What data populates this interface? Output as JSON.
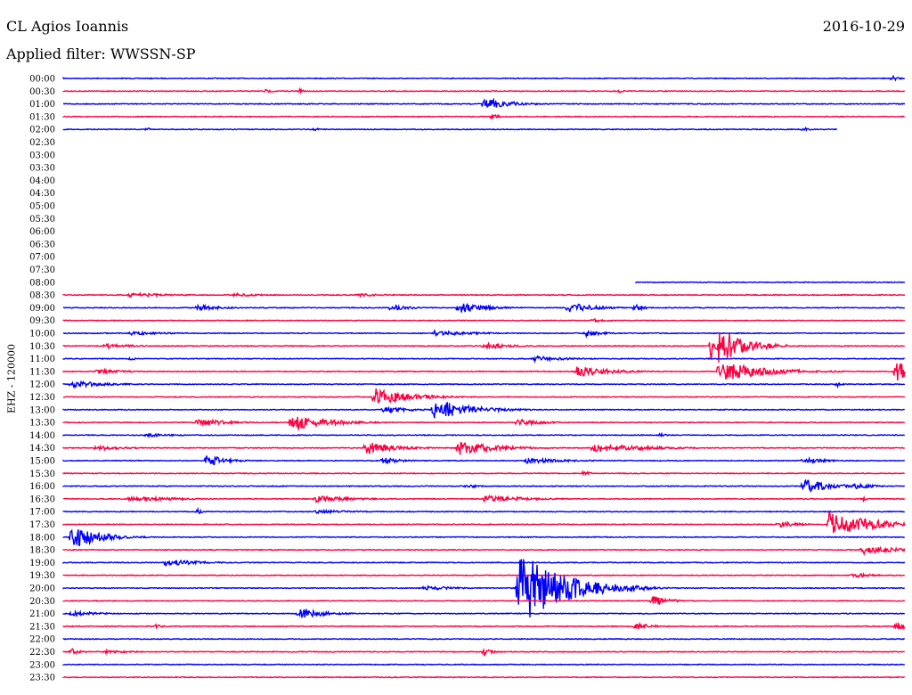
{
  "header": {
    "station": "CL Agios Ioannis",
    "date": "2016-10-29",
    "filter": "Applied filter: WWSSN-SP"
  },
  "axis": {
    "ylabel": "EHZ - 120000"
  },
  "colors": {
    "odd": "#0000ff",
    "even": "#ff0040"
  },
  "chart_data": {
    "type": "line",
    "title": "CL Agios Ioannis",
    "subtitle": "Applied filter: WWSSN-SP",
    "ylabel": "EHZ - 120000",
    "row_labels": [
      "00:00",
      "00:30",
      "01:00",
      "01:30",
      "02:00",
      "02:30",
      "03:00",
      "03:30",
      "04:00",
      "04:30",
      "05:00",
      "05:30",
      "06:00",
      "06:30",
      "07:00",
      "07:30",
      "08:00",
      "08:30",
      "09:00",
      "09:30",
      "10:00",
      "10:30",
      "11:00",
      "11:30",
      "12:00",
      "12:30",
      "13:00",
      "13:30",
      "14:00",
      "14:30",
      "15:00",
      "15:30",
      "16:00",
      "16:30",
      "17:00",
      "17:30",
      "18:00",
      "18:30",
      "19:00",
      "19:30",
      "20:00",
      "20:30",
      "21:00",
      "21:30",
      "22:00",
      "22:30",
      "23:00",
      "23:30"
    ],
    "row_span_minutes": 30,
    "traces": [
      {
        "row": "00:00",
        "start": 0,
        "end": 1.0,
        "events": [
          {
            "t": 0.985,
            "a": 3,
            "d": 0.008
          }
        ]
      },
      {
        "row": "00:30",
        "start": 0,
        "end": 1.0,
        "events": [
          {
            "t": 0.24,
            "a": 2,
            "d": 0.01
          },
          {
            "t": 0.28,
            "a": 3,
            "d": 0.005
          },
          {
            "t": 0.66,
            "a": 2,
            "d": 0.006
          }
        ]
      },
      {
        "row": "01:00",
        "start": 0,
        "end": 1.0,
        "events": [
          {
            "t": 0.5,
            "a": 7,
            "d": 0.03
          }
        ]
      },
      {
        "row": "01:30",
        "start": 0,
        "end": 1.0,
        "events": [
          {
            "t": 0.51,
            "a": 3,
            "d": 0.008
          }
        ]
      },
      {
        "row": "02:00",
        "start": 0,
        "end": 0.92,
        "events": [
          {
            "t": 0.1,
            "a": 2,
            "d": 0.005
          },
          {
            "t": 0.3,
            "a": 2,
            "d": 0.01
          },
          {
            "t": 0.88,
            "a": 3,
            "d": 0.006
          }
        ]
      },
      {
        "row": "08:00",
        "start": 0.68,
        "end": 1.0,
        "events": []
      },
      {
        "row": "08:30",
        "start": 0,
        "end": 1.0,
        "events": [
          {
            "t": 0.08,
            "a": 3,
            "d": 0.04
          },
          {
            "t": 0.2,
            "a": 2,
            "d": 0.04
          },
          {
            "t": 0.35,
            "a": 2,
            "d": 0.03
          }
        ]
      },
      {
        "row": "09:00",
        "start": 0,
        "end": 1.0,
        "events": [
          {
            "t": 0.16,
            "a": 3,
            "d": 0.03
          },
          {
            "t": 0.39,
            "a": 4,
            "d": 0.02
          },
          {
            "t": 0.47,
            "a": 6,
            "d": 0.03
          },
          {
            "t": 0.6,
            "a": 6,
            "d": 0.03
          },
          {
            "t": 0.68,
            "a": 4,
            "d": 0.01
          }
        ]
      },
      {
        "row": "09:30",
        "start": 0,
        "end": 1.0,
        "events": [
          {
            "t": 0.63,
            "a": 2,
            "d": 0.02
          }
        ]
      },
      {
        "row": "10:00",
        "start": 0,
        "end": 1.0,
        "events": [
          {
            "t": 0.08,
            "a": 2,
            "d": 0.05
          },
          {
            "t": 0.44,
            "a": 3,
            "d": 0.05
          },
          {
            "t": 0.62,
            "a": 4,
            "d": 0.02
          }
        ]
      },
      {
        "row": "10:30",
        "start": 0,
        "end": 1.0,
        "events": [
          {
            "t": 0.05,
            "a": 3,
            "d": 0.03
          },
          {
            "t": 0.5,
            "a": 4,
            "d": 0.03
          },
          {
            "t": 0.77,
            "a": 28,
            "d": 0.03
          }
        ]
      },
      {
        "row": "11:00",
        "start": 0,
        "end": 1.0,
        "events": [
          {
            "t": 0.08,
            "a": 3,
            "d": 0.005
          },
          {
            "t": 0.56,
            "a": 3,
            "d": 0.04
          }
        ]
      },
      {
        "row": "11:30",
        "start": 0,
        "end": 1.0,
        "events": [
          {
            "t": 0.04,
            "a": 3,
            "d": 0.03
          },
          {
            "t": 0.61,
            "a": 6,
            "d": 0.04
          },
          {
            "t": 0.78,
            "a": 12,
            "d": 0.05
          },
          {
            "t": 0.99,
            "a": 12,
            "d": 0.02
          }
        ]
      },
      {
        "row": "12:00",
        "start": 0,
        "end": 1.0,
        "events": [
          {
            "t": 0.01,
            "a": 4,
            "d": 0.04
          },
          {
            "t": 0.92,
            "a": 3,
            "d": 0.005
          }
        ]
      },
      {
        "row": "12:30",
        "start": 0,
        "end": 1.0,
        "events": [
          {
            "t": 0.37,
            "a": 10,
            "d": 0.04
          }
        ]
      },
      {
        "row": "13:00",
        "start": 0,
        "end": 1.0,
        "events": [
          {
            "t": 0.38,
            "a": 4,
            "d": 0.03
          },
          {
            "t": 0.44,
            "a": 12,
            "d": 0.04
          }
        ]
      },
      {
        "row": "13:30",
        "start": 0,
        "end": 1.0,
        "events": [
          {
            "t": 0.16,
            "a": 5,
            "d": 0.03
          },
          {
            "t": 0.27,
            "a": 10,
            "d": 0.04
          },
          {
            "t": 0.54,
            "a": 4,
            "d": 0.03
          }
        ]
      },
      {
        "row": "14:00",
        "start": 0,
        "end": 1.0,
        "events": [
          {
            "t": 0.1,
            "a": 2,
            "d": 0.03
          },
          {
            "t": 0.71,
            "a": 3,
            "d": 0.005
          }
        ]
      },
      {
        "row": "14:30",
        "start": 0,
        "end": 1.0,
        "events": [
          {
            "t": 0.04,
            "a": 3,
            "d": 0.03
          },
          {
            "t": 0.36,
            "a": 8,
            "d": 0.03
          },
          {
            "t": 0.47,
            "a": 9,
            "d": 0.04
          },
          {
            "t": 0.63,
            "a": 5,
            "d": 0.06
          }
        ]
      },
      {
        "row": "15:00",
        "start": 0,
        "end": 1.0,
        "events": [
          {
            "t": 0.17,
            "a": 8,
            "d": 0.02
          },
          {
            "t": 0.38,
            "a": 4,
            "d": 0.02
          },
          {
            "t": 0.55,
            "a": 3,
            "d": 0.05
          },
          {
            "t": 0.88,
            "a": 3,
            "d": 0.03
          }
        ]
      },
      {
        "row": "15:30",
        "start": 0,
        "end": 1.0,
        "events": [
          {
            "t": 0.62,
            "a": 4,
            "d": 0.005
          }
        ]
      },
      {
        "row": "16:00",
        "start": 0,
        "end": 1.0,
        "events": [
          {
            "t": 0.48,
            "a": 2,
            "d": 0.02
          },
          {
            "t": 0.88,
            "a": 8,
            "d": 0.03
          },
          {
            "t": 0.94,
            "a": 4,
            "d": 0.02
          }
        ]
      },
      {
        "row": "16:30",
        "start": 0,
        "end": 1.0,
        "events": [
          {
            "t": 0.08,
            "a": 3,
            "d": 0.06
          },
          {
            "t": 0.3,
            "a": 4,
            "d": 0.04
          },
          {
            "t": 0.5,
            "a": 4,
            "d": 0.05
          },
          {
            "t": 0.95,
            "a": 3,
            "d": 0.005
          }
        ]
      },
      {
        "row": "17:00",
        "start": 0,
        "end": 1.0,
        "events": [
          {
            "t": 0.16,
            "a": 3,
            "d": 0.005
          },
          {
            "t": 0.3,
            "a": 2,
            "d": 0.05
          }
        ]
      },
      {
        "row": "17:30",
        "start": 0,
        "end": 1.0,
        "events": [
          {
            "t": 0.85,
            "a": 4,
            "d": 0.02
          },
          {
            "t": 0.91,
            "a": 14,
            "d": 0.05
          }
        ]
      },
      {
        "row": "18:00",
        "start": 0,
        "end": 1.0,
        "events": [
          {
            "t": 0.01,
            "a": 14,
            "d": 0.03
          }
        ]
      },
      {
        "row": "18:30",
        "start": 0,
        "end": 1.0,
        "events": [
          {
            "t": 0.95,
            "a": 5,
            "d": 0.04
          }
        ]
      },
      {
        "row": "19:00",
        "start": 0,
        "end": 1.0,
        "events": [
          {
            "t": 0.12,
            "a": 4,
            "d": 0.04
          }
        ]
      },
      {
        "row": "19:30",
        "start": 0,
        "end": 1.0,
        "events": [
          {
            "t": 0.94,
            "a": 3,
            "d": 0.02
          }
        ]
      },
      {
        "row": "20:00",
        "start": 0,
        "end": 1.0,
        "events": [
          {
            "t": 0.43,
            "a": 3,
            "d": 0.03
          },
          {
            "t": 0.54,
            "a": 45,
            "d": 0.05
          },
          {
            "t": 0.67,
            "a": 4,
            "d": 0.03
          }
        ]
      },
      {
        "row": "20:30",
        "start": 0,
        "end": 1.0,
        "events": [
          {
            "t": 0.7,
            "a": 6,
            "d": 0.02
          }
        ]
      },
      {
        "row": "21:00",
        "start": 0,
        "end": 1.0,
        "events": [
          {
            "t": 0.01,
            "a": 3,
            "d": 0.03
          },
          {
            "t": 0.28,
            "a": 6,
            "d": 0.03
          }
        ]
      },
      {
        "row": "21:30",
        "start": 0,
        "end": 1.0,
        "events": [
          {
            "t": 0.11,
            "a": 2,
            "d": 0.01
          },
          {
            "t": 0.68,
            "a": 4,
            "d": 0.02
          },
          {
            "t": 0.99,
            "a": 6,
            "d": 0.01
          }
        ]
      },
      {
        "row": "22:00",
        "start": 0,
        "end": 1.0,
        "events": []
      },
      {
        "row": "22:30",
        "start": 0,
        "end": 1.0,
        "events": [
          {
            "t": 0.01,
            "a": 4,
            "d": 0.01
          },
          {
            "t": 0.05,
            "a": 2,
            "d": 0.03
          },
          {
            "t": 0.5,
            "a": 5,
            "d": 0.008
          }
        ]
      },
      {
        "row": "23:00",
        "start": 0,
        "end": 1.0,
        "events": []
      },
      {
        "row": "23:30",
        "start": 0,
        "end": 1.0,
        "events": []
      }
    ]
  }
}
